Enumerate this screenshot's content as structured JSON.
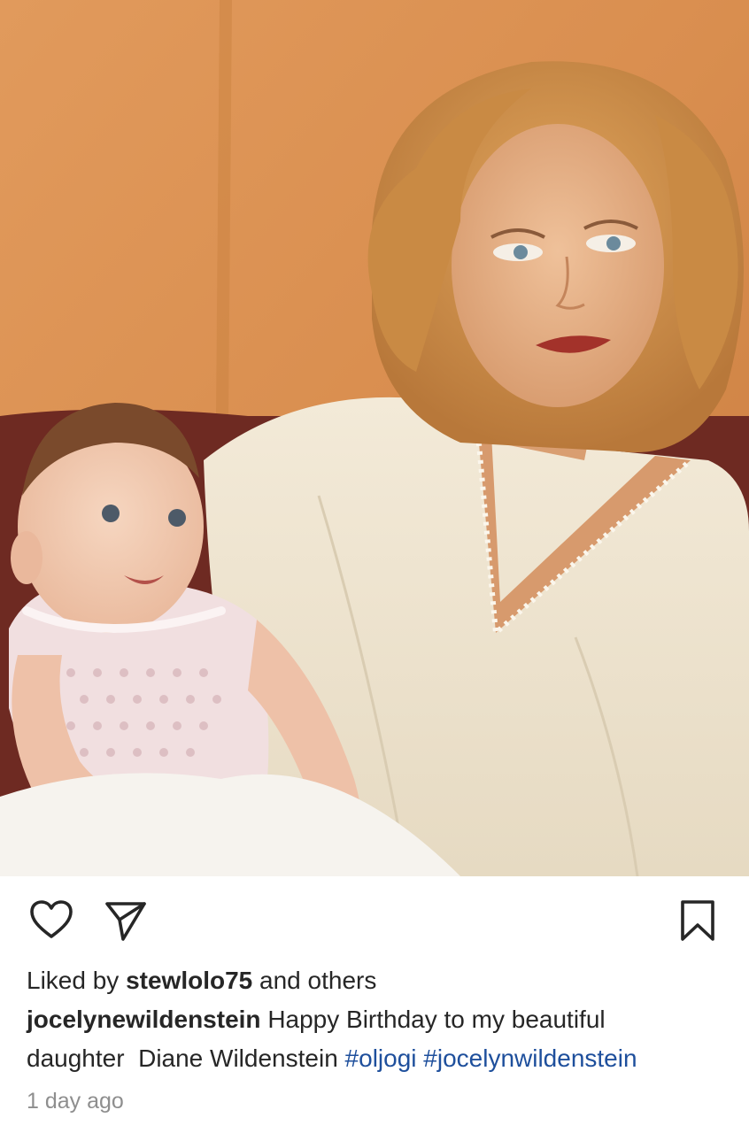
{
  "post": {
    "photo": {
      "alt_icon": "photo-image",
      "colors": {
        "wall": "#d98e4f",
        "hair": "#c98a44",
        "garment": "#efe6d4",
        "skin": "#e7b48d",
        "lips": "#a3322a",
        "sofa": "#6e2a22"
      }
    },
    "actions": {
      "like_icon": "heart-outline-icon",
      "share_icon": "paper-plane-icon",
      "save_icon": "bookmark-outline-icon"
    },
    "likes": {
      "prefix": "Liked by",
      "user": "stewlolo75",
      "suffix": "and others"
    },
    "caption": {
      "author": "jocelynewildenstein",
      "text_line1": "Happy Birthday to my beautiful",
      "text_line2": "daughter  Diane Wildenstein",
      "hashtags": [
        "#oljogi",
        "#jocelynwildenstein"
      ]
    },
    "timestamp": "1 day ago",
    "colors": {
      "text": "#262626",
      "hashtag": "#1e4f9c",
      "muted": "#8e8e8e"
    }
  }
}
